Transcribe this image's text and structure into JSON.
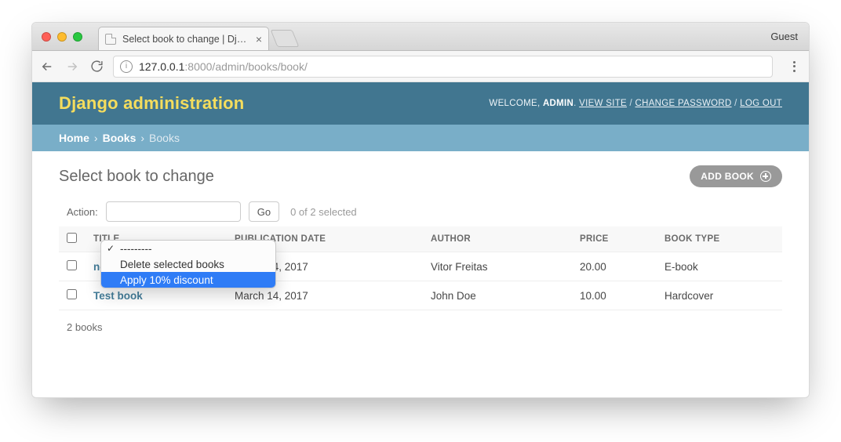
{
  "window": {
    "guest_label": "Guest",
    "tab_title": "Select book to change | Django"
  },
  "address": "127.0.0.1:8000/admin/books/book/",
  "address_muted_suffix": ":8000/admin/books/book/",
  "address_host": "127.0.0.1",
  "header": {
    "brand": "Django administration",
    "welcome": "WELCOME,",
    "username": "ADMIN",
    "view_site": "VIEW SITE",
    "change_password": "CHANGE PASSWORD",
    "log_out": "LOG OUT"
  },
  "breadcrumbs": {
    "home": "Home",
    "parent": "Books",
    "current": "Books"
  },
  "page": {
    "heading": "Select book to change",
    "add_button": "ADD BOOK"
  },
  "action": {
    "label": "Action:",
    "go": "Go",
    "selection_text": "0 of 2 selected",
    "options": [
      "---------",
      "Delete selected books",
      "Apply 10% discount"
    ],
    "checked_index": 0,
    "highlighted_index": 2
  },
  "table": {
    "columns": [
      "TITLE",
      "PUBLICATION DATE",
      "AUTHOR",
      "PRICE",
      "BOOK TYPE"
    ],
    "rows": [
      {
        "title": "new",
        "publication_date": "March 14, 2017",
        "author": "Vitor Freitas",
        "price": "20.00",
        "book_type": "E-book"
      },
      {
        "title": "Test book",
        "publication_date": "March 14, 2017",
        "author": "John Doe",
        "price": "10.00",
        "book_type": "Hardcover"
      }
    ],
    "summary": "2 books"
  }
}
